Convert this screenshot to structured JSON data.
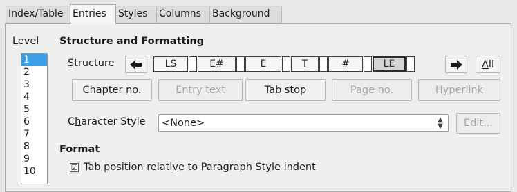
{
  "tabs": [
    {
      "label": "Index/Table",
      "active": false
    },
    {
      "label": "Entries",
      "active": true
    },
    {
      "label": "Styles",
      "active": false
    },
    {
      "label": "Columns",
      "active": false
    },
    {
      "label": "Background",
      "active": false
    }
  ],
  "level": {
    "heading_accel": "L",
    "heading_rest": "evel",
    "items": [
      "1",
      "2",
      "3",
      "4",
      "5",
      "6",
      "7",
      "8",
      "9",
      "10"
    ],
    "selected": "1"
  },
  "structure_section": {
    "heading": "Structure and Formatting",
    "structure_label_accel": "S",
    "structure_label_rest": "tructure",
    "left_arrow_icon": "arrow-left-icon",
    "right_arrow_icon": "arrow-right-icon",
    "tokens": [
      {
        "label": "LS",
        "selected": false
      },
      {
        "label": "E#",
        "selected": false
      },
      {
        "label": "E",
        "selected": false
      },
      {
        "label": "T",
        "selected": false
      },
      {
        "label": "#",
        "selected": false
      },
      {
        "label": "LE",
        "selected": true
      }
    ],
    "all_button_accel": "A",
    "all_button_rest": "ll"
  },
  "insert_buttons": {
    "chapter_pre": "Chapter ",
    "chapter_accel": "n",
    "chapter_post": "o.",
    "entry_pre": "Entry te",
    "entry_accel": "x",
    "entry_post": "t",
    "tabstop_pre": "Ta",
    "tabstop_accel": "b",
    "tabstop_post": " stop",
    "pageno_pre": "Pa",
    "pageno_accel": "g",
    "pageno_post": "e no.",
    "hyperlink_pre": "H",
    "hyperlink_accel": "y",
    "hyperlink_post": "perlink"
  },
  "character_style": {
    "label_pre": "C",
    "label_accel": "h",
    "label_post": "aracter Style",
    "value": "<None>",
    "edit_accel": "E",
    "edit_rest": "dit..."
  },
  "format": {
    "heading": "Format",
    "tab_position_pre": "Tab position relati",
    "tab_position_accel": "v",
    "tab_position_post": "e to Paragraph Style indent",
    "tab_position_checked": true,
    "check_mark": "☑"
  }
}
